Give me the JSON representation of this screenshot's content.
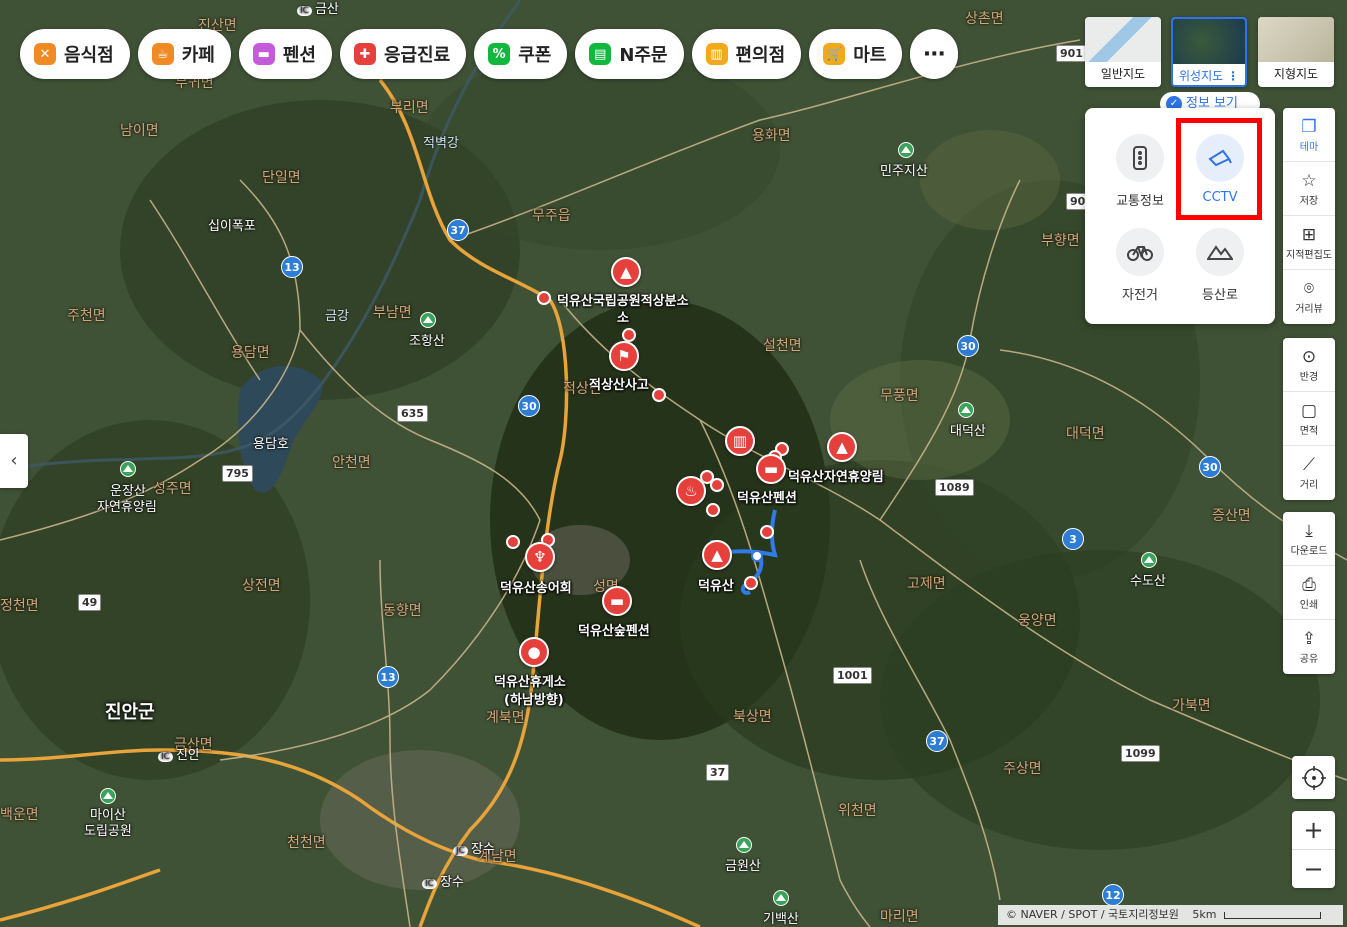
{
  "categories": [
    {
      "label": "음식점",
      "color": "#f08a24",
      "icon": "fork-knife-icon"
    },
    {
      "label": "카페",
      "color": "#f08a24",
      "icon": "cup-icon"
    },
    {
      "label": "펜션",
      "color": "#c45bd8",
      "icon": "bed-icon"
    },
    {
      "label": "응급진료",
      "color": "#e5403b",
      "icon": "cross-icon"
    },
    {
      "label": "쿠폰",
      "color": "#12b83e",
      "icon": "coupon-icon"
    },
    {
      "label": "N주문",
      "color": "#12b83e",
      "icon": "order-icon"
    },
    {
      "label": "편의점",
      "color": "#f2a91a",
      "icon": "store-icon"
    },
    {
      "label": "마트",
      "color": "#f2a91a",
      "icon": "cart-icon"
    },
    {
      "label": "⋯",
      "icon": "more-icon"
    }
  ],
  "map_types": [
    {
      "label": "일반지도",
      "active": false
    },
    {
      "label": "위성지도",
      "active": true
    },
    {
      "label": "지형지도",
      "active": false
    }
  ],
  "info_button": "정보 보기",
  "layers": [
    {
      "label": "교통정보",
      "icon": "traffic-light-icon",
      "active": false
    },
    {
      "label": "CCTV",
      "icon": "cctv-icon",
      "active": true
    },
    {
      "label": "자전거",
      "icon": "bicycle-icon",
      "active": false
    },
    {
      "label": "등산로",
      "icon": "mountain-icon",
      "active": false
    }
  ],
  "tools_top": [
    {
      "label": "테마",
      "icon": "layers-icon",
      "active": true
    },
    {
      "label": "저장",
      "icon": "star-icon"
    },
    {
      "label": "지적편집도",
      "icon": "grid-icon"
    },
    {
      "label": "거리뷰",
      "icon": "street-view-icon"
    }
  ],
  "tools_measure": [
    {
      "label": "반경",
      "icon": "radius-icon"
    },
    {
      "label": "면적",
      "icon": "area-icon"
    },
    {
      "label": "거리",
      "icon": "ruler-icon"
    }
  ],
  "tools_share": [
    {
      "label": "다운로드",
      "icon": "download-icon"
    },
    {
      "label": "인쇄",
      "icon": "print-icon"
    },
    {
      "label": "공유",
      "icon": "share-icon"
    }
  ],
  "attribution": "© NAVER / SPOT / 국토지리정보원",
  "scale": "5km",
  "pois": {
    "p1": "덕유산국립공원적상분소",
    "p2": "적상산사고",
    "p3": "덕유산자연휴양림",
    "p4": "덕유산펜션",
    "p5": "덕유산",
    "p6": "덕유산송어회",
    "p7": "덕유산숲펜션",
    "p8": "덕유산휴게소",
    "p8b": "(하남방향)"
  },
  "places": {
    "sibipokpo": "십이폭포",
    "johangsan": "조항산",
    "yongdamho": "용담호",
    "unjangsan": "운장산",
    "unjangsan2": "자연휴양림",
    "minjusan": "민주지산",
    "daedeoksan": "대덕산",
    "sudosan": "수도산",
    "maisan": "마이산",
    "maisan2": "도립공원",
    "geumwonsan": "금원산",
    "gibaeksan": "기백산",
    "jinan_ic": "진안",
    "jangsu_jc": "장수",
    "jangsu_ic": "장수",
    "geumsan_ic": "금산",
    "ic": "IC",
    "jc": "JC"
  },
  "regions": {
    "r1": "진산면",
    "r2": "남이면",
    "r3": "부리면",
    "r4": "적벽강",
    "r5": "용화면",
    "r6": "단일면",
    "r7": "무주읍",
    "r8": "부향면",
    "r9": "주천면",
    "r10": "금강",
    "r11": "부남면",
    "r12": "용담면",
    "r13": "설천면",
    "r14": "적상면",
    "r15": "무풍면",
    "r16": "안천면",
    "r17": "대덕면",
    "r18": "상전면",
    "r19": "동향면",
    "r20": "성면",
    "r21": "고제면",
    "r22": "증산면",
    "r23": "웅양면",
    "r24": "계북면",
    "r25": "북상면",
    "r26": "가북면",
    "r27": "주상면",
    "r28": "천천면",
    "r29": "계남면",
    "r30": "위천면",
    "r31": "마리면",
    "r32": "상촌면",
    "r33": "백운면",
    "r34": "부귀면",
    "r35": "정천면",
    "r36": "금산면",
    "r37": "성주면",
    "big": "진안군"
  },
  "roads": {
    "a": "37",
    "b": "13",
    "c": "30",
    "d": "635",
    "e": "795",
    "f": "49",
    "g": "13",
    "h": "30",
    "i": "1089",
    "j": "30",
    "k": "3",
    "l": "1001",
    "m": "37",
    "n": "37",
    "o": "1099",
    "p": "12",
    "q": "901",
    "r": "90"
  }
}
